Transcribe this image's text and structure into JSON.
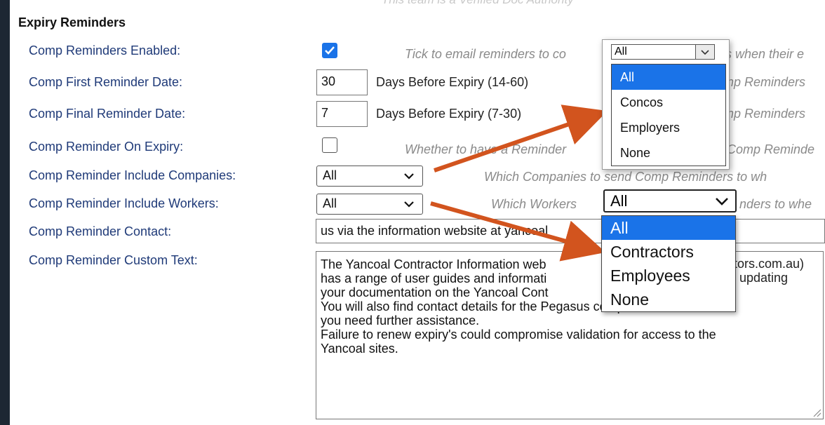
{
  "ghost_text": "This team is a Verified Doc Authority",
  "section_title": "Expiry Reminders",
  "rows": {
    "enabled": {
      "label": "Comp Reminders Enabled:",
      "checked": true,
      "hint": "Tick to email reminders to co",
      "hint_tail": "s when their e"
    },
    "first": {
      "label": "Comp First Reminder Date:",
      "value": "30",
      "suffix": "Days Before Expiry (14-60)",
      "hint_tail": "np Reminders"
    },
    "final": {
      "label": "Comp Final Reminder Date:",
      "value": "7",
      "suffix": "Days Before Expiry (7-30)",
      "hint_tail": "np Reminders"
    },
    "on_expiry": {
      "label": "Comp Reminder On Expiry:",
      "checked": false,
      "hint": "Whether to have a Reminder",
      "hint_tail": "Comp Reminde"
    },
    "companies": {
      "label": "Comp Reminder Include Companies:",
      "value": "All",
      "hint": "Which Companies to send Comp Reminders to wh"
    },
    "workers": {
      "label": "Comp Reminder Include Workers:",
      "value": "All",
      "hint": "Which Workers",
      "hint_tail": "nders to whe"
    },
    "contact": {
      "label": "Comp Reminder Contact:",
      "value": "us via the information website at yancoal"
    },
    "custom_text": {
      "label": "Comp Reminder Custom Text:",
      "lines": [
        "The Yancoal Contractor Information web",
        "has a range of user guides and informati",
        "your documentation on the Yancoal Cont",
        "You will also find contact details for the Pegasus compliance team should",
        "you need further assistance.",
        "Failure to renew expiry's could compromise validation for access to the",
        "Yancoal sites."
      ],
      "fragment_1": "tors.com.au)",
      "fragment_2": "updating"
    }
  },
  "companies_dropdown": {
    "value": "All",
    "options": [
      "All",
      "Concos",
      "Employers",
      "None"
    ],
    "highlighted": "All"
  },
  "workers_dropdown": {
    "value": "All",
    "options": [
      "All",
      "Contractors",
      "Employees",
      "None"
    ],
    "highlighted": "All"
  },
  "colors": {
    "label": "#1f3a78",
    "hint": "#8a8a8a",
    "highlight": "#1a73e8",
    "arrow": "#d2541e"
  }
}
